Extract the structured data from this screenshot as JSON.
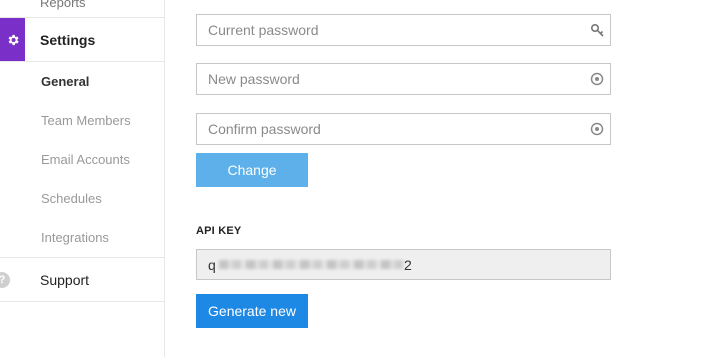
{
  "sidebar": {
    "reports_label": "Reports",
    "settings_label": "Settings",
    "sub_items": [
      "General",
      "Team Members",
      "Email Accounts",
      "Schedules",
      "Integrations"
    ],
    "active_sub_item": "General",
    "support_label": "Support",
    "support_icon_glyph": "?",
    "accent_color": "#7b2fc9"
  },
  "password": {
    "current_placeholder": "Current password",
    "new_placeholder": "New password",
    "confirm_placeholder": "Confirm password",
    "change_label": "Change"
  },
  "api": {
    "heading": "API KEY",
    "key_prefix": "q",
    "key_suffix": "2",
    "key_masked": true,
    "generate_label": "Generate new"
  },
  "icons": {
    "settings": "gear-icon",
    "reports": "reports-icon",
    "support": "help-circle-icon",
    "current_password_field": "password-manager-key-icon",
    "new_password_field": "password-manager-icon",
    "confirm_password_field": "password-manager-icon"
  },
  "colors": {
    "change_button": "#5eb0ea",
    "generate_button": "#1e88e5",
    "api_box_bg": "#efefef"
  }
}
